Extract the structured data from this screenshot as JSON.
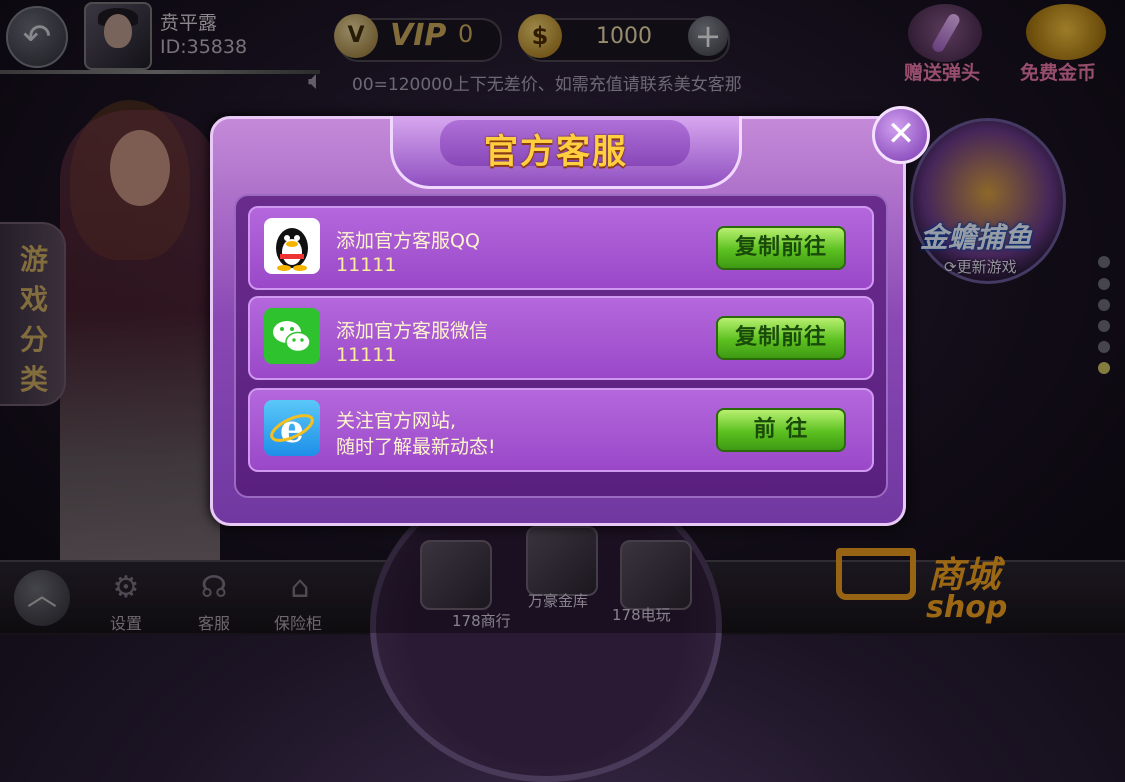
{
  "header": {
    "back_icon": "back-arrow-icon",
    "player_name": "贲平露",
    "player_id": "ID:35838",
    "vip_badge": "V",
    "vip_label": "VIP",
    "vip_level": "0",
    "coin_symbol": "$",
    "coins": "1000",
    "add_icon": "plus-icon",
    "notice": "00=120000上下无差价、如需充值请联系美女客那"
  },
  "right_actions": {
    "gift_label": "赠送弹头",
    "free_coins_label": "免费金币"
  },
  "left": {
    "category_label": "游戏分类"
  },
  "featured_game": {
    "title": "金蟾捕鱼",
    "update_label": "更新游戏"
  },
  "bottom_nav": {
    "items": [
      {
        "label": "设置",
        "icon": "gear-icon"
      },
      {
        "label": "客服",
        "icon": "headset-icon"
      },
      {
        "label": "保险柜",
        "icon": "vault-icon"
      }
    ],
    "rooms": [
      {
        "label": "178商行"
      },
      {
        "label": "万豪金库"
      },
      {
        "label": "178电玩"
      }
    ],
    "shop_cn": "商城",
    "shop_en": "shop"
  },
  "dialog": {
    "title": "官方客服",
    "rows": [
      {
        "icon": "qq-penguin-icon",
        "title": "添加官方客服QQ",
        "sub": "11111",
        "button": "复制前往"
      },
      {
        "icon": "wechat-icon",
        "title": "添加官方客服微信",
        "sub": "11111",
        "button": "复制前往"
      },
      {
        "icon": "ie-browser-icon",
        "title": "关注官方网站,",
        "sub": "随时了解最新动态!",
        "button": "前 往"
      }
    ]
  },
  "colors": {
    "dialog_purple": "#8a48b4",
    "title_gold": "#ffcf40",
    "button_green": "#5cc020"
  }
}
